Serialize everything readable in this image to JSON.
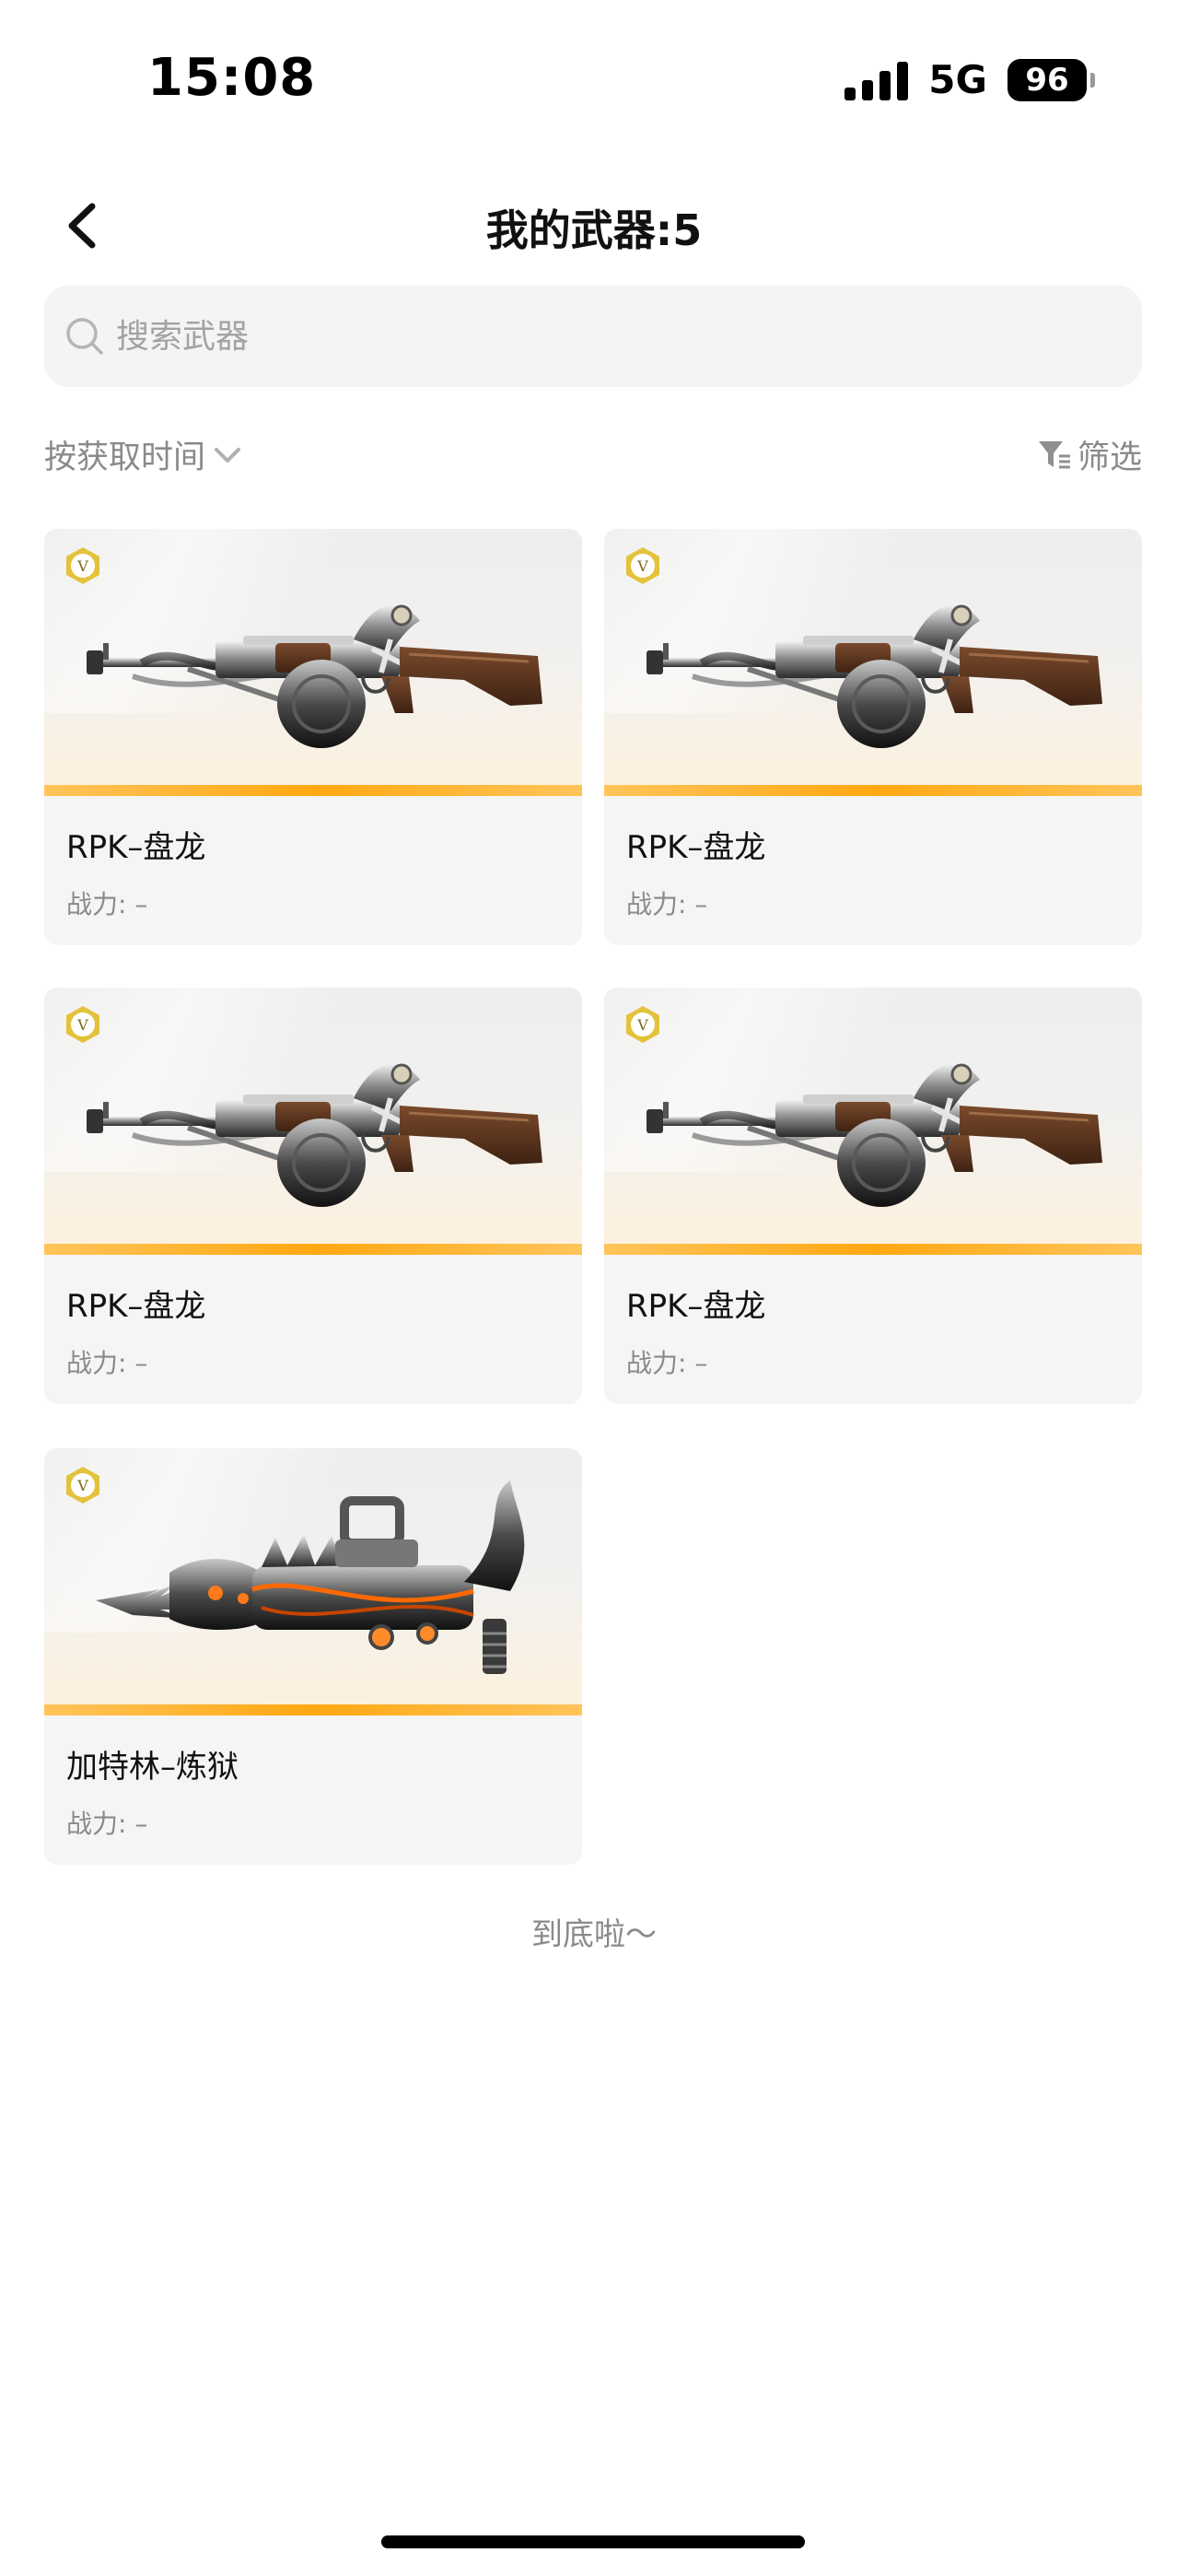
{
  "status_bar": {
    "time": "15:08",
    "network": "5G",
    "battery": "96"
  },
  "header": {
    "title": "我的武器:5"
  },
  "search": {
    "placeholder": "搜索武器",
    "value": ""
  },
  "toolbar": {
    "sort_label": "按获取时间",
    "filter_label": "筛选"
  },
  "weapons": [
    {
      "name": "RPK–盘龙",
      "power": "战力: –",
      "icon": "rpk-rifle-image"
    },
    {
      "name": "RPK–盘龙",
      "power": "战力: –",
      "icon": "rpk-rifle-image"
    },
    {
      "name": "RPK–盘龙",
      "power": "战力: –",
      "icon": "rpk-rifle-image"
    },
    {
      "name": "RPK–盘龙",
      "power": "战力: –",
      "icon": "rpk-rifle-image"
    },
    {
      "name": "加特林–炼狱",
      "power": "战力: –",
      "icon": "gatling-dragon-image"
    }
  ],
  "footer": {
    "end_text": "到底啦～"
  },
  "colors": {
    "accent": "#ffa812",
    "card_bg": "#f5f5f5",
    "muted_text": "#8a8a8a"
  }
}
